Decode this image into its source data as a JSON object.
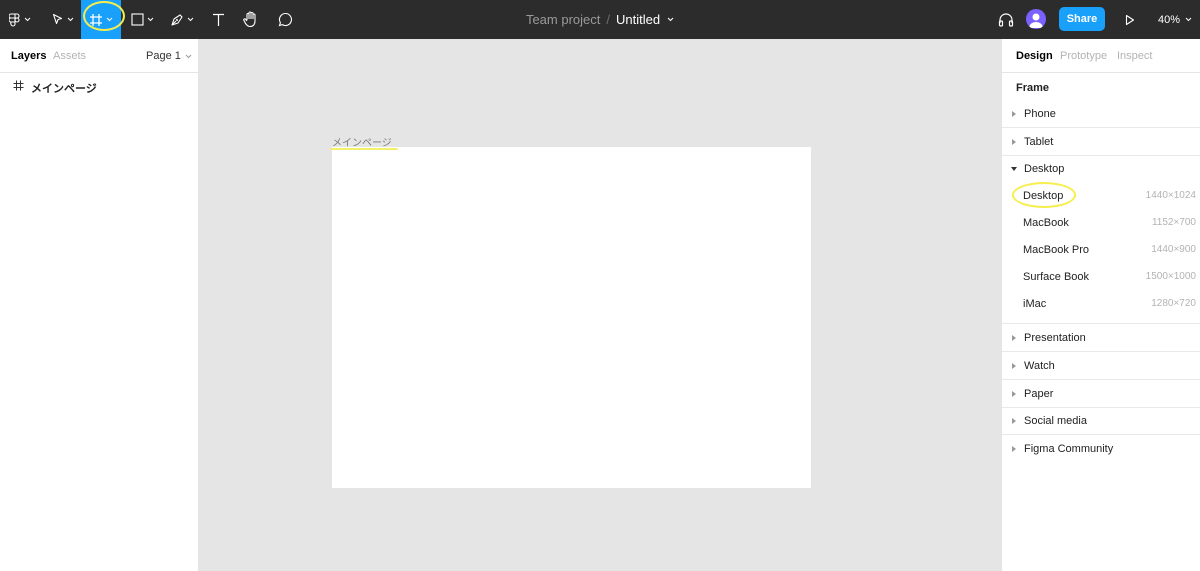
{
  "toolbar": {
    "tools": [
      {
        "icon": "figma-menu-icon"
      },
      {
        "icon": "move-tool-icon"
      },
      {
        "icon": "frame-tool-icon",
        "active": true
      },
      {
        "icon": "rectangle-tool-icon"
      },
      {
        "icon": "pen-tool-icon"
      },
      {
        "icon": "text-tool-icon"
      },
      {
        "icon": "hand-tool-icon"
      },
      {
        "icon": "comment-tool-icon"
      }
    ],
    "project": "Team project",
    "separator": "/",
    "file_name": "Untitled",
    "share_label": "Share",
    "zoom": "40%",
    "accent_color": "#18a0fb"
  },
  "left_panel": {
    "tabs": [
      "Layers",
      "Assets"
    ],
    "page": "Page 1",
    "layers": [
      {
        "label": "メインページ",
        "icon": "frame-icon"
      }
    ]
  },
  "canvas": {
    "frame_label": "メインページ",
    "background": "#e5e5e5"
  },
  "right_panel": {
    "tabs": [
      "Design",
      "Prototype",
      "Inspect"
    ],
    "heading": "Frame",
    "categories_before": [
      "Phone",
      "Tablet"
    ],
    "expanded_category": "Desktop",
    "presets": [
      {
        "name": "Desktop",
        "size": "1440×1024"
      },
      {
        "name": "MacBook",
        "size": "1152×700"
      },
      {
        "name": "MacBook Pro",
        "size": "1440×900"
      },
      {
        "name": "Surface Book",
        "size": "1500×1000"
      },
      {
        "name": "iMac",
        "size": "1280×720"
      }
    ],
    "categories_after": [
      "Presentation",
      "Watch",
      "Paper",
      "Social media",
      "Figma Community"
    ]
  }
}
